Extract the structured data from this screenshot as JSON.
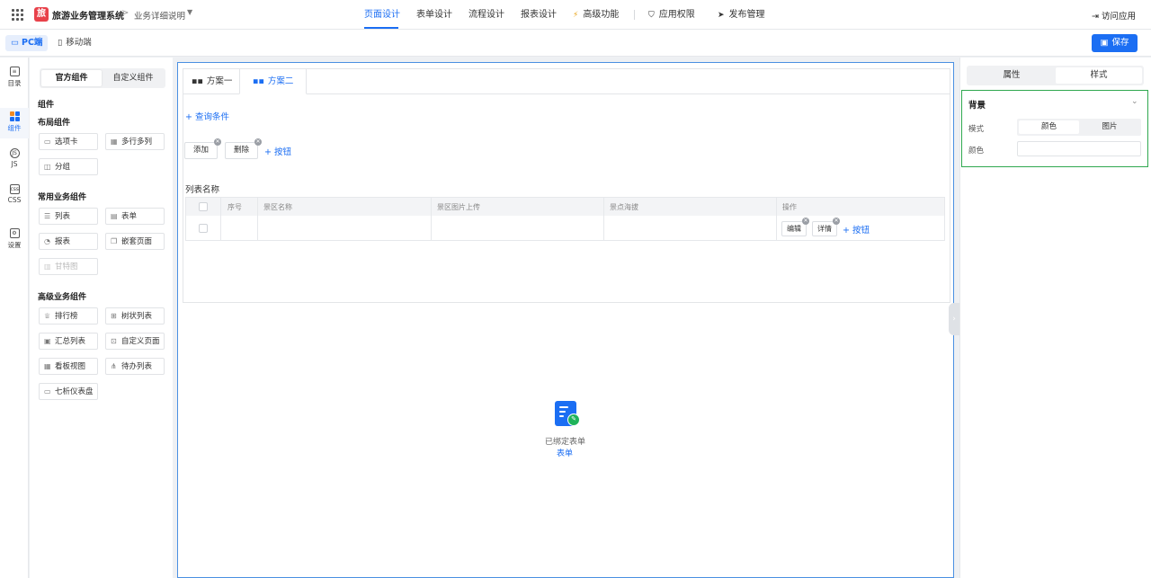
{
  "app": {
    "logo_char": "旅",
    "title": "旅游业务管理系统",
    "breadcrumb_sep": ">",
    "breadcrumb": "业务详细说明",
    "nav_tabs": [
      {
        "label": "页面设计",
        "active": true
      },
      {
        "label": "表单设计"
      },
      {
        "label": "流程设计"
      },
      {
        "label": "报表设计"
      },
      {
        "label": "高级功能"
      },
      {
        "label": "应用权限"
      },
      {
        "label": "发布管理"
      }
    ],
    "visit_label": "访问应用"
  },
  "subbar": {
    "pc_label": "PC端",
    "mobile_label": "移动端",
    "save_label": "保存"
  },
  "rail": [
    {
      "label": "目录",
      "icon": "directory-icon"
    },
    {
      "label": "组件",
      "icon": "components-icon",
      "active": true
    },
    {
      "label": "JS",
      "icon": "js-icon"
    },
    {
      "label": "CSS",
      "icon": "css-icon"
    },
    {
      "label": "设置",
      "icon": "settings-icon"
    }
  ],
  "component_panel": {
    "tabs": [
      "官方组件",
      "自定义组件"
    ],
    "heading": "组件",
    "groups": [
      {
        "title": "布局组件",
        "items": [
          {
            "label": "选项卡",
            "icon": "folder-icon"
          },
          {
            "label": "多行多列",
            "icon": "grid-icon"
          },
          {
            "label": "分组",
            "icon": "group-icon"
          }
        ]
      },
      {
        "title": "常用业务组件",
        "items": [
          {
            "label": "列表",
            "icon": "list-icon"
          },
          {
            "label": "表单",
            "icon": "form-icon"
          },
          {
            "label": "报表",
            "icon": "report-icon"
          },
          {
            "label": "嵌套页面",
            "icon": "nested-page-icon"
          },
          {
            "label": "甘特图",
            "icon": "gantt-icon",
            "disabled": true
          }
        ]
      },
      {
        "title": "高级业务组件",
        "items": [
          {
            "label": "排行榜",
            "icon": "trophy-icon"
          },
          {
            "label": "树状列表",
            "icon": "tree-icon"
          },
          {
            "label": "汇总列表",
            "icon": "summary-icon"
          },
          {
            "label": "自定义页面",
            "icon": "custom-page-icon"
          },
          {
            "label": "看板视图",
            "icon": "kanban-icon"
          },
          {
            "label": "待办列表",
            "icon": "todo-icon"
          },
          {
            "label": "七析仪表盘",
            "icon": "dashboard-icon"
          }
        ]
      }
    ]
  },
  "canvas": {
    "schemes": [
      "方案一",
      "方案二"
    ],
    "active_scheme": 1,
    "query_label": "+ 查询条件",
    "buttons": [
      "添加",
      "删除"
    ],
    "add_button_label": "+ 按钮",
    "list_title": "列表名称",
    "columns": [
      "序号",
      "景区名称",
      "景区图片上传",
      "景点海拔",
      "操作"
    ],
    "row_actions": [
      "编辑",
      "详情"
    ],
    "row_add_label": "+ 按钮",
    "bound_text": "已绑定表单",
    "bound_link": "表单"
  },
  "right_panel": {
    "tabs": [
      "属性",
      "样式"
    ],
    "active_tab": 1,
    "section_title": "背景",
    "mode_label": "模式",
    "modes": [
      "颜色",
      "图片"
    ],
    "active_mode": 0,
    "color_label": "颜色",
    "color_value": "",
    "highlight_color": "#2fa84f",
    "accent_color": "#1b6ef3"
  }
}
